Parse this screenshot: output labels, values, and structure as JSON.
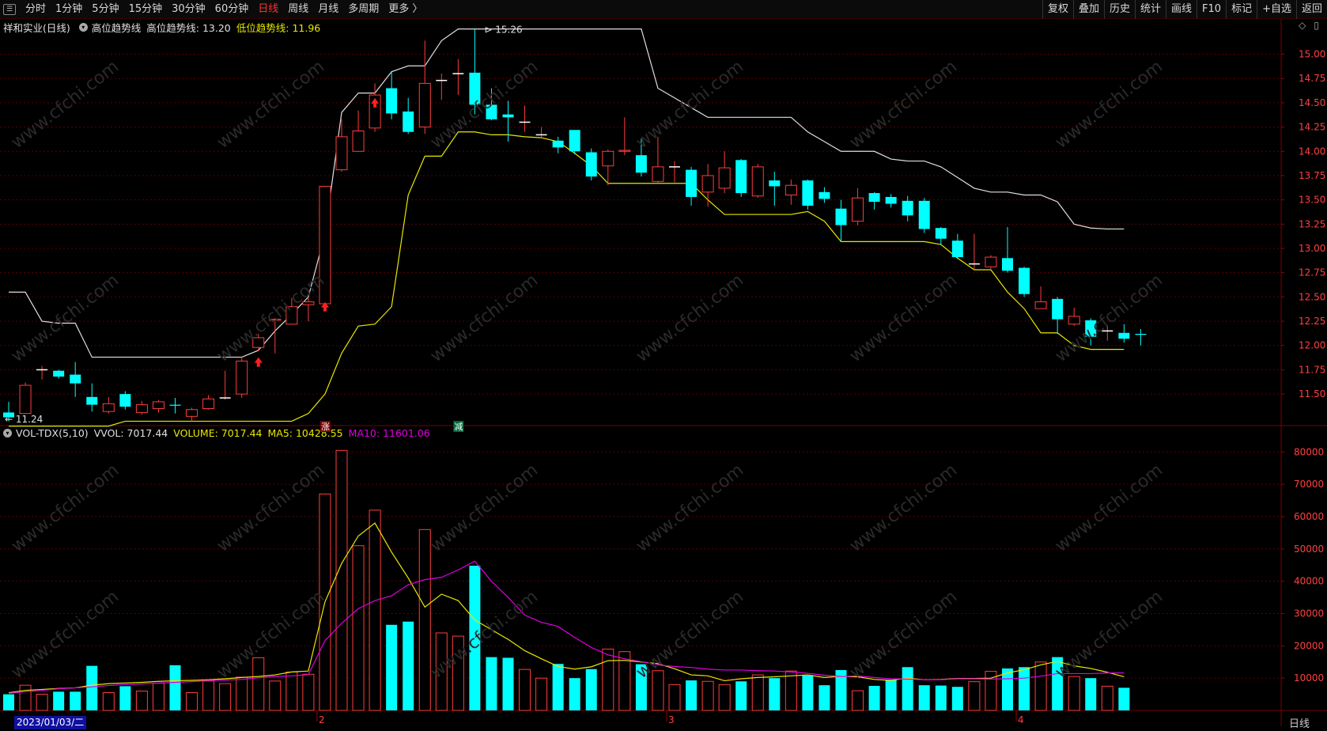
{
  "toolbar": {
    "periods": [
      "分时",
      "1分钟",
      "5分钟",
      "15分钟",
      "30分钟",
      "60分钟",
      "日线",
      "周线",
      "月线",
      "多周期",
      "更多 〉"
    ],
    "active_period": "日线",
    "right_buttons": [
      "复权",
      "叠加",
      "历史",
      "统计",
      "画线",
      "F10",
      "标记",
      "+自选",
      "返回"
    ]
  },
  "price_pane": {
    "title": "祥和实业(日线)",
    "indicator_name": "高位趋势线",
    "high_label": "高位趋势线: 13.20",
    "low_label": "低位趋势线: 11.96",
    "max_mark": "15.26",
    "min_mark": "11.24",
    "tag_up": "涨",
    "tag_down": "减",
    "y_ticks": [
      "15.00",
      "14.75",
      "14.50",
      "14.25",
      "14.00",
      "13.75",
      "13.50",
      "13.25",
      "13.00",
      "12.75",
      "12.50",
      "12.25",
      "12.00",
      "11.75",
      "11.50"
    ]
  },
  "volume_pane": {
    "indicator": "VOL-TDX(5,10)",
    "vvol": "VVOL: 7017.44",
    "volume": "VOLUME: 7017.44",
    "ma5": "MA5: 10428.55",
    "ma10": "MA10: 11601.06",
    "y_ticks": [
      "80000",
      "70000",
      "60000",
      "50000",
      "40000",
      "30000",
      "20000",
      "10000"
    ]
  },
  "x_axis": {
    "selected_date": "2023/01/03/二",
    "month_labels": [
      "2",
      "3",
      "4"
    ],
    "period_label": "日线"
  },
  "watermark": "www.cfchi.com",
  "colors": {
    "up": "#ff3c3c",
    "down": "#00ffff",
    "high_line": "#e0e0e0",
    "low_line": "#e8e800",
    "ma5": "#e8e800",
    "ma10": "#e000e0",
    "grid": "#5a0000"
  },
  "chart_data": {
    "type": "candlestick",
    "ohlc": [
      [
        11.31,
        11.26,
        11.42,
        11.22
      ],
      [
        11.3,
        11.59,
        11.62,
        11.3
      ],
      [
        11.75,
        11.75,
        11.79,
        11.65
      ],
      [
        11.74,
        11.68,
        11.75,
        11.66
      ],
      [
        11.7,
        11.61,
        11.83,
        11.47
      ],
      [
        11.47,
        11.39,
        11.61,
        11.32
      ],
      [
        11.32,
        11.4,
        11.47,
        11.3
      ],
      [
        11.5,
        11.37,
        11.53,
        11.34
      ],
      [
        11.31,
        11.39,
        11.43,
        11.29
      ],
      [
        11.35,
        11.42,
        11.44,
        11.31
      ],
      [
        11.39,
        11.38,
        11.46,
        11.3
      ],
      [
        11.27,
        11.34,
        11.36,
        11.22
      ],
      [
        11.35,
        11.45,
        11.49,
        11.34
      ],
      [
        11.46,
        11.46,
        11.74,
        11.44
      ],
      [
        11.5,
        11.84,
        11.88,
        11.46
      ],
      [
        11.98,
        12.08,
        12.12,
        11.94
      ],
      [
        12.26,
        12.27,
        12.28,
        11.92
      ],
      [
        12.22,
        12.4,
        12.49,
        12.22
      ],
      [
        12.42,
        12.45,
        12.5,
        12.25
      ],
      [
        12.43,
        13.64,
        13.64,
        12.39
      ],
      [
        13.81,
        14.15,
        14.33,
        13.79
      ],
      [
        14.0,
        14.21,
        14.42,
        14.0
      ],
      [
        14.24,
        14.58,
        14.7,
        14.2
      ],
      [
        14.65,
        14.39,
        14.82,
        14.33
      ],
      [
        14.41,
        14.2,
        14.55,
        14.18
      ],
      [
        14.25,
        14.7,
        15.14,
        14.18
      ],
      [
        14.73,
        14.73,
        14.8,
        14.53
      ],
      [
        14.8,
        14.8,
        14.95,
        14.58
      ],
      [
        14.81,
        14.48,
        15.26,
        14.38
      ],
      [
        14.48,
        14.33,
        14.65,
        14.32
      ],
      [
        14.38,
        14.35,
        14.52,
        14.1
      ],
      [
        14.3,
        14.3,
        14.47,
        14.2
      ],
      [
        14.17,
        14.17,
        14.25,
        14.14
      ],
      [
        14.11,
        14.04,
        14.15,
        13.98
      ],
      [
        14.22,
        14.0,
        14.22,
        13.97
      ],
      [
        13.99,
        13.74,
        14.03,
        13.7
      ],
      [
        13.85,
        14.0,
        14.02,
        13.65
      ],
      [
        14.0,
        14.01,
        14.35,
        13.96
      ],
      [
        13.96,
        13.78,
        14.13,
        13.74
      ],
      [
        13.69,
        13.84,
        14.15,
        13.67
      ],
      [
        13.84,
        13.84,
        13.9,
        13.68
      ],
      [
        13.81,
        13.53,
        13.84,
        13.44
      ],
      [
        13.58,
        13.75,
        13.87,
        13.43
      ],
      [
        13.62,
        13.83,
        14.0,
        13.57
      ],
      [
        13.91,
        13.57,
        13.92,
        13.53
      ],
      [
        13.54,
        13.84,
        13.87,
        13.52
      ],
      [
        13.7,
        13.64,
        13.79,
        13.44
      ],
      [
        13.55,
        13.65,
        13.71,
        13.45
      ],
      [
        13.7,
        13.44,
        13.71,
        13.4
      ],
      [
        13.58,
        13.51,
        13.63,
        13.47
      ],
      [
        13.41,
        13.24,
        13.5,
        13.07
      ],
      [
        13.28,
        13.52,
        13.62,
        13.24
      ],
      [
        13.57,
        13.48,
        13.58,
        13.4
      ],
      [
        13.53,
        13.46,
        13.56,
        13.42
      ],
      [
        13.49,
        13.34,
        13.54,
        13.28
      ],
      [
        13.49,
        13.2,
        13.52,
        13.16
      ],
      [
        13.21,
        13.1,
        13.22,
        13.04
      ],
      [
        13.08,
        12.91,
        13.15,
        12.89
      ],
      [
        12.84,
        12.84,
        13.15,
        12.78
      ],
      [
        12.81,
        12.91,
        12.93,
        12.79
      ],
      [
        12.9,
        12.77,
        13.22,
        12.75
      ],
      [
        12.8,
        12.53,
        12.81,
        12.5
      ],
      [
        12.38,
        12.45,
        12.61,
        12.38
      ],
      [
        12.48,
        12.27,
        12.5,
        12.12
      ],
      [
        12.22,
        12.3,
        12.39,
        12.2
      ],
      [
        12.26,
        12.09,
        12.28,
        12.0
      ],
      [
        12.15,
        12.15,
        12.21,
        12.05
      ],
      [
        12.13,
        12.07,
        12.22,
        12.03
      ],
      [
        12.12,
        12.11,
        12.17,
        12.0
      ]
    ],
    "volume": [
      5000,
      7800,
      5000,
      5800,
      5800,
      13800,
      5500,
      7500,
      6000,
      8400,
      14000,
      5500,
      9100,
      8300,
      10300,
      16300,
      9100,
      11900,
      11200,
      67000,
      80500,
      51000,
      62000,
      26500,
      27500,
      56000,
      24000,
      23000,
      44800,
      16500,
      16300,
      12700,
      10000,
      14400,
      10000,
      12800,
      19000,
      18200,
      14300,
      12300,
      8000,
      9300,
      9000,
      8000,
      9000,
      11000,
      10000,
      12200,
      10800,
      7800,
      12500,
      6100,
      7600,
      9500,
      13400,
      7800,
      7700,
      7300,
      8900,
      12100,
      13000,
      13400,
      15000,
      16500,
      10500,
      10000,
      7500,
      7017.44
    ],
    "high_trend": [
      12.55,
      12.55,
      12.25,
      12.23,
      12.23,
      11.88,
      11.88,
      11.88,
      11.88,
      11.88,
      11.88,
      11.88,
      11.88,
      11.88,
      11.88,
      11.95,
      12.15,
      12.32,
      12.5,
      13.15,
      14.4,
      14.6,
      14.6,
      14.82,
      14.88,
      14.88,
      15.14,
      15.26,
      15.26,
      15.26,
      15.26,
      15.26,
      15.26,
      15.26,
      15.26,
      15.26,
      15.26,
      15.26,
      15.26,
      14.65,
      14.55,
      14.45,
      14.35,
      14.35,
      14.35,
      14.35,
      14.35,
      14.35,
      14.2,
      14.1,
      14.0,
      14.0,
      14.0,
      13.92,
      13.9,
      13.9,
      13.84,
      13.73,
      13.62,
      13.58,
      13.58,
      13.55,
      13.55,
      13.48,
      13.25,
      13.21,
      13.2,
      13.2
    ],
    "low_trend": [
      11.17,
      11.17,
      11.17,
      11.17,
      11.17,
      11.17,
      11.17,
      11.22,
      11.22,
      11.22,
      11.22,
      11.22,
      11.22,
      11.22,
      11.22,
      11.22,
      11.22,
      11.22,
      11.3,
      11.5,
      11.92,
      12.2,
      12.22,
      12.4,
      13.55,
      13.95,
      13.95,
      14.2,
      14.2,
      14.17,
      14.17,
      14.15,
      14.14,
      14.1,
      13.98,
      13.85,
      13.67,
      13.67,
      13.67,
      13.67,
      13.67,
      13.67,
      13.5,
      13.35,
      13.35,
      13.35,
      13.35,
      13.35,
      13.38,
      13.28,
      13.07,
      13.07,
      13.07,
      13.07,
      13.07,
      13.07,
      13.04,
      12.9,
      12.78,
      12.78,
      12.55,
      12.38,
      12.13,
      12.13,
      12.0,
      11.96,
      11.96,
      11.96
    ],
    "ma5": [
      5500,
      6200,
      6500,
      6800,
      7000,
      7800,
      8300,
      8500,
      8700,
      9000,
      9200,
      9300,
      9500,
      9800,
      10200,
      10500,
      11000,
      11900,
      12200,
      33600,
      45500,
      54000,
      58000,
      49000,
      41000,
      32000,
      36000,
      34000,
      28000,
      25000,
      22000,
      18500,
      16000,
      13600,
      12800,
      13500,
      15400,
      15500,
      15000,
      14500,
      12900,
      11000,
      10700,
      9200,
      9800,
      10200,
      10400,
      10700,
      11000,
      10200,
      10600,
      10400,
      9600,
      9300,
      10000,
      9500,
      9600,
      9900,
      9900,
      10000,
      11600,
      12600,
      14100,
      15200,
      13800,
      13000,
      11800,
      10428.55
    ],
    "ma10": [
      5300,
      5800,
      6200,
      6700,
      7000,
      7300,
      7700,
      8000,
      8200,
      8500,
      8700,
      8900,
      9200,
      9400,
      9600,
      10100,
      10500,
      10700,
      11100,
      21600,
      27000,
      31500,
      34000,
      35500,
      38900,
      40500,
      41200,
      43500,
      46200,
      40000,
      35000,
      29500,
      27300,
      26000,
      22600,
      19500,
      17200,
      16000,
      15100,
      14100,
      13600,
      13300,
      12800,
      12500,
      12500,
      12300,
      12200,
      11900,
      11500,
      10900,
      10500,
      10700,
      10200,
      9800,
      9700,
      9500,
      9500,
      9800,
      9800,
      9700,
      9800,
      10000,
      10600,
      11400,
      11400,
      11400,
      11600,
      11601.06
    ]
  }
}
